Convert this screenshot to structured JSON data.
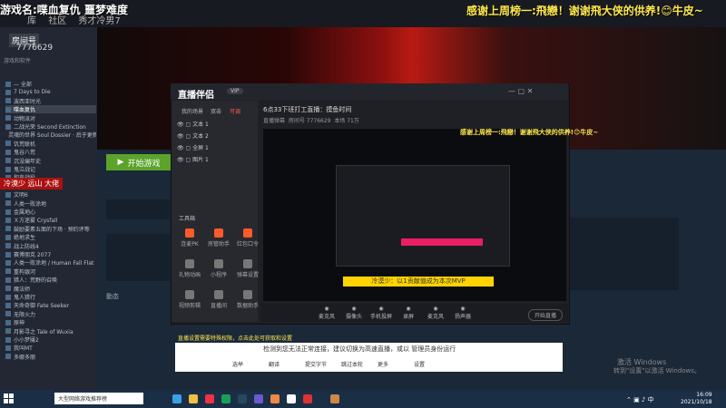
{
  "stream": {
    "title": "游戏名:喋血复仇  噩梦难度",
    "ticker": "感谢上周榜一:飛戀！谢谢飛大侠的供养!😊牛皮~"
  },
  "steam": {
    "menu": [
      "库",
      "社区",
      "秀才冷男7"
    ],
    "room_label": "房间号",
    "room_id": "7776629",
    "filter_label": "游戏和软件",
    "games": [
      "— 全部",
      "7 Days to Die",
      "波西亚时光",
      "喋血复仇",
      "动物派对",
      "二战光荣 Second Extinction",
      "灵魂的世界 Soul Dossier · 后于更新",
      "饥荒联机",
      "鬼谷八荒",
      "沉没编年史",
      "鬼泣战记",
      "和声战役",
      "废墟图书馆",
      "文明6",
      "人类一败涂地",
      "金属地心",
      "Ｘ方迷雾 Crysfall",
      "鼓励要素五面的下场 · 预约评等",
      "绝地求生",
      "战上防线4",
      "赛博朋克 2077",
      "人类一败涂地 / Human Fall Flat",
      "重构银河",
      "猎人：荒野的召唤",
      "魔法师",
      "鬼人猎行",
      "天命奇御 Fate Seeker",
      "无限火力",
      "原神",
      "月影寻之 Tale of Wuxia",
      "小小梦魇2",
      "我叫MT",
      "多娜多丽"
    ],
    "play_button": "开始游戏",
    "friend_chat": "冷漠少   远山 大佬",
    "activity": "動态"
  },
  "obs": {
    "brand": "直播伴侣",
    "vip": "VIP",
    "tabs": [
      "我的场景",
      "双击",
      "可调"
    ],
    "sources": [
      "文本 1",
      "文本 2",
      "全屏 1",
      "图片 1"
    ],
    "tools_label": "工具箱",
    "tools": [
      "连麦PK",
      "房管助手",
      "红包口令",
      "礼物动画",
      "小程序",
      "弹幕设置",
      "视频剪辑",
      "直播间",
      "数据助手"
    ],
    "room_title": "6点33下班打工直播：摸鱼时间",
    "meta": [
      "直播弹幕",
      "房间号  7776629",
      "本场 71万"
    ],
    "preview_banner": "感谢上周榜一:飛戀！谢谢飛大侠的供养!😊牛皮~",
    "mvp_text": "冷漠少：以1贡献值成为本次MVP",
    "bottom": [
      "麦克风",
      "摄像头",
      "手机投屏",
      "录屏",
      "麦克风",
      "扬声器"
    ],
    "start_live": "开始直播"
  },
  "ime": {
    "warning": "直播设置需要特殊权限，点击此处可获取和设置",
    "text": "检测到您无法正常连接，建议切换为高速直播，或以 管理员身份运行",
    "items": [
      "选举",
      "翻译",
      "提交字节",
      "跳过本轮",
      "更多",
      "设置"
    ]
  },
  "windows": {
    "search": "大型网络游戏推荐榜",
    "activate": "激活 Windows",
    "activate_sub": "转到\"设置\"以激活 Windows。",
    "time": "16:09",
    "date": "2021/10/18"
  }
}
